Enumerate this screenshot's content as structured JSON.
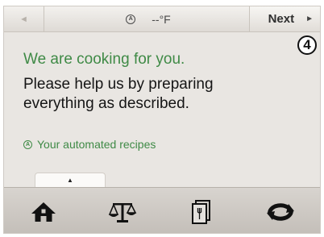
{
  "topbar": {
    "back_arrow": "◄",
    "temperature": "--°F",
    "next_label": "Next",
    "next_arrow": "►"
  },
  "step_badge": "4",
  "main": {
    "heading": "We are cooking for you.",
    "body_line1": "Please help us by preparing",
    "body_line2": "everything as described.",
    "recipes_link": "Your automated recipes"
  },
  "icons": {
    "clock_glyph": "A",
    "recipes_glyph": "A",
    "handle_glyph": "▲"
  },
  "bottom_nav": [
    {
      "icon": "home-icon"
    },
    {
      "icon": "scale-icon"
    },
    {
      "icon": "cookbook-icon"
    },
    {
      "icon": "rotate-icon"
    }
  ],
  "colors": {
    "accent_green": "#3f8a46",
    "screen_bg": "#e9e6e2",
    "bottom_bar": "#c9c4bf"
  }
}
